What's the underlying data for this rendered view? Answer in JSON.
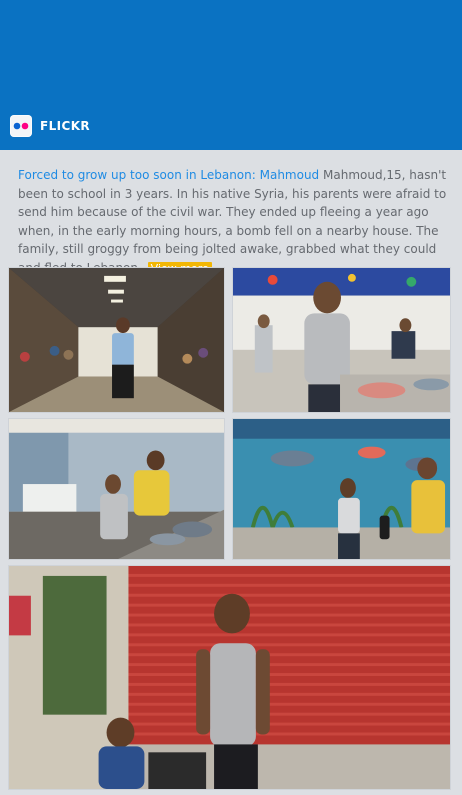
{
  "header": {
    "brand_label": "FLICKR",
    "colors": {
      "bar": "#0a72c2",
      "link": "#1f8be3",
      "view_more_bg": "#f2b705"
    }
  },
  "post": {
    "title": "Forced to grow up too soon in Lebanon: Mahmoud",
    "body": "Mahmoud,15, hasn't been to school in 3 years. In his native Syria, his parents were afraid to send him because of the civil war. They ended up fleeing a year ago when, in the early morning hours, a bomb fell on a nearby house. The family, still groggy from being jolted awake, grabbed what they could and fled to Lebanon.",
    "view_more": "View more"
  },
  "photos": [
    {
      "id": "photo-1",
      "alt": "Boy standing in a market corridor"
    },
    {
      "id": "photo-2",
      "alt": "Boy cleaning fish at a counter"
    },
    {
      "id": "photo-3",
      "alt": "Boy and man at a fish stall"
    },
    {
      "id": "photo-4",
      "alt": "Boy handing fish in front of a sea mural"
    },
    {
      "id": "photo-5",
      "alt": "Boy standing in front of a red shutter"
    }
  ]
}
